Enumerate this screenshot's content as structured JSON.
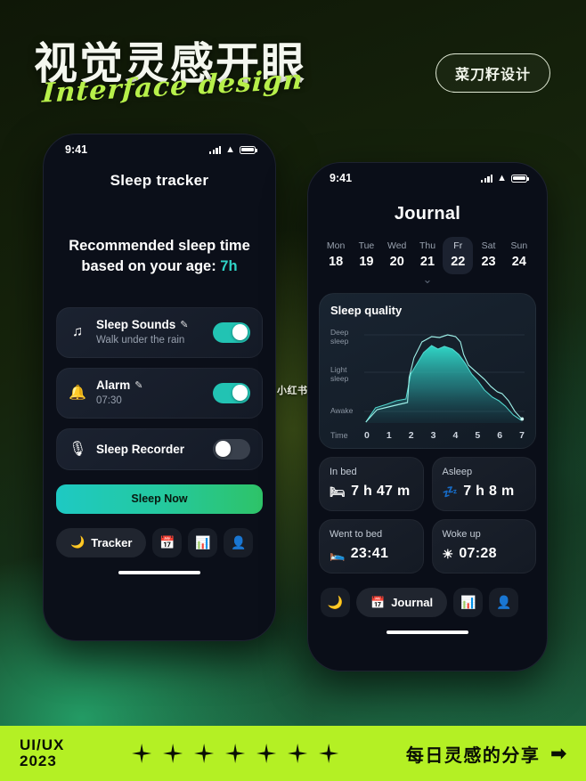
{
  "poster": {
    "zh_title": "视觉灵感开眼",
    "en_title": "Interface design",
    "badge": "菜刀籽设计",
    "watermark": "小红书"
  },
  "left_phone": {
    "status": {
      "time": "9:41"
    },
    "title": "Sleep tracker",
    "recommend_line1": "Recommended sleep time",
    "recommend_line2": "based  on your age:",
    "recommend_value": "7h",
    "rows": [
      {
        "icon": "music-note-icon",
        "glyph": "♫",
        "title": "Sleep Sounds",
        "edit": "✎",
        "sub": "Walk under the rain",
        "toggle": "on"
      },
      {
        "icon": "bell-icon",
        "glyph": "🔔",
        "title": "Alarm",
        "edit": "✎",
        "sub": "07:30",
        "toggle": "on"
      },
      {
        "icon": "microphone-icon",
        "glyph": "🎙",
        "title": "Sleep Recorder",
        "edit": "",
        "sub": "",
        "toggle": "off"
      }
    ],
    "primary_button": "Sleep Now",
    "nav": {
      "active_label": "Tracker",
      "active_glyph": "🌙",
      "items": [
        {
          "name": "calendar",
          "glyph": "📅"
        },
        {
          "name": "stats",
          "glyph": "📊"
        },
        {
          "name": "profile",
          "glyph": "👤"
        }
      ]
    }
  },
  "right_phone": {
    "status": {
      "time": "9:41"
    },
    "title": "Journal",
    "week": [
      {
        "dow": "Mon",
        "day": "18",
        "selected": false
      },
      {
        "dow": "Tue",
        "day": "19",
        "selected": false
      },
      {
        "dow": "Wed",
        "day": "20",
        "selected": false
      },
      {
        "dow": "Thu",
        "day": "21",
        "selected": false
      },
      {
        "dow": "Fr",
        "day": "22",
        "selected": true
      },
      {
        "dow": "Sat",
        "day": "23",
        "selected": false
      },
      {
        "dow": "Sun",
        "day": "24",
        "selected": false
      }
    ],
    "chart_title": "Sleep quality",
    "stats": [
      {
        "label": "In bed",
        "glyph": "🛏",
        "value": "7 h 47 m"
      },
      {
        "label": "Asleep",
        "glyph": "💤",
        "value": "7 h 8 m"
      },
      {
        "label": "Went to bed",
        "glyph": "🛌",
        "value": "23:41"
      },
      {
        "label": "Woke up",
        "glyph": "☀",
        "value": "07:28"
      }
    ],
    "nav": {
      "active_label": "Journal",
      "active_glyph": "📅",
      "items": [
        {
          "name": "moon",
          "glyph": "🌙"
        },
        {
          "name": "stats",
          "glyph": "📊"
        },
        {
          "name": "profile",
          "glyph": "👤"
        }
      ]
    }
  },
  "chart_data": {
    "type": "area",
    "title": "Sleep quality",
    "xlabel": "Time",
    "ylabel": "",
    "x": [
      0,
      1,
      2,
      3,
      4,
      5,
      6,
      7
    ],
    "xticklabels": [
      "0",
      "1",
      "2",
      "3",
      "4",
      "5",
      "6",
      "7"
    ],
    "yticklabels": [
      "Deep sleep",
      "Light sleep",
      "Awake"
    ],
    "ylim": [
      0,
      3
    ],
    "grid": true,
    "legend": "none",
    "series": [
      {
        "name": "sleep-depth-area",
        "color": "#2bd4c6",
        "values": [
          0.05,
          0.85,
          1.05,
          2.35,
          2.25,
          2.5,
          1.35,
          0.6,
          0.15
        ]
      },
      {
        "name": "sleep-depth-line",
        "color": "#7fe8e0",
        "values": [
          0.05,
          0.8,
          1.0,
          2.7,
          2.62,
          2.68,
          1.5,
          0.72,
          0.2
        ]
      }
    ]
  },
  "footer": {
    "line1": "UI/UX",
    "line2": "2023",
    "stars": 7,
    "text": "每日灵感的分享",
    "arrow": "➡"
  }
}
